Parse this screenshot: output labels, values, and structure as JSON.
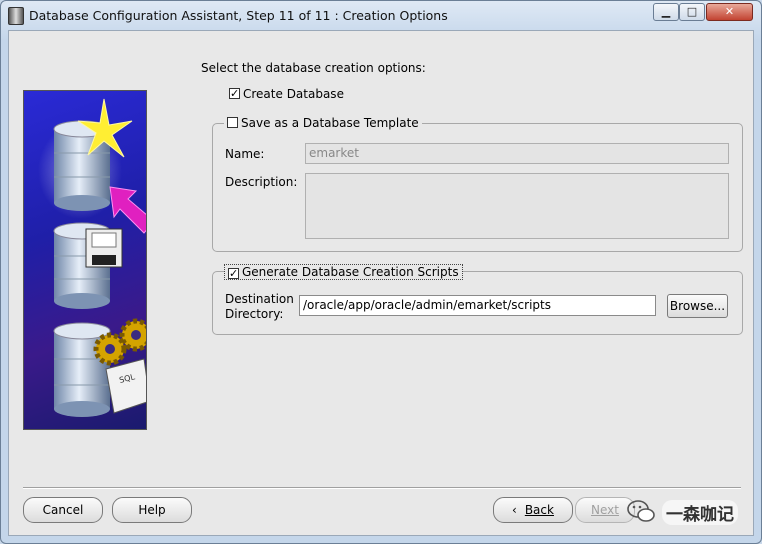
{
  "window": {
    "title": "Database Configuration Assistant, Step 11 of 11 : Creation Options"
  },
  "intro": "Select the database creation options:",
  "create_database": {
    "label": "Create Database",
    "checked": true
  },
  "template": {
    "label": "Save as a Database Template",
    "checked": false,
    "name_label": "Name:",
    "name_value": "emarket",
    "description_label": "Description:",
    "description_value": ""
  },
  "scripts": {
    "label": "Generate Database Creation Scripts",
    "checked": true,
    "dest_label_1": "Destination",
    "dest_label_2": "Directory:",
    "dest_value": "/oracle/app/oracle/admin/emarket/scripts",
    "browse_label": "Browse..."
  },
  "buttons": {
    "cancel": "Cancel",
    "help": "Help",
    "back": "Back",
    "next": "Next"
  },
  "watermark": "一森咖记",
  "colors": {
    "accent_arrow": "#e020c0",
    "panel_bg": "#2a2ad6"
  }
}
